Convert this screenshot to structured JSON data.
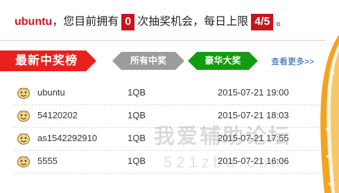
{
  "chance_line": {
    "username": "ubuntu",
    "text_before": "，您目前拥有",
    "chances": "0",
    "text_middle": "次抽奖机会，每日上限",
    "daily_limit": "4/5",
    "text_end": "。"
  },
  "tabs": {
    "latest": "最新中奖榜",
    "all": "所有中奖",
    "luxury": "豪华大奖",
    "more_link": "查看更多>>"
  },
  "winners": [
    {
      "user": "ubuntu",
      "prize": "1QB",
      "time": "2015-07-21 19:00"
    },
    {
      "user": "54120202",
      "prize": "1QB",
      "time": "2015-07-21 18:03"
    },
    {
      "user": "as1542292910",
      "prize": "1QB",
      "time": "2015-07-21 17:55"
    },
    {
      "user": "5555",
      "prize": "1QB",
      "time": "2015-07-21 16:06"
    }
  ],
  "watermark": {
    "title": "我爱辅助论坛",
    "url": "521zba.com"
  },
  "colors": {
    "accent_red": "#c9141b",
    "banner_red": "#e8211f",
    "gray_tab": "#9c9c9c",
    "green_tab": "#129c10",
    "link_blue": "#1a55b0",
    "wheel_orange": "#f4a320"
  },
  "icons": {
    "row_icon": "smiley-face-icon"
  }
}
